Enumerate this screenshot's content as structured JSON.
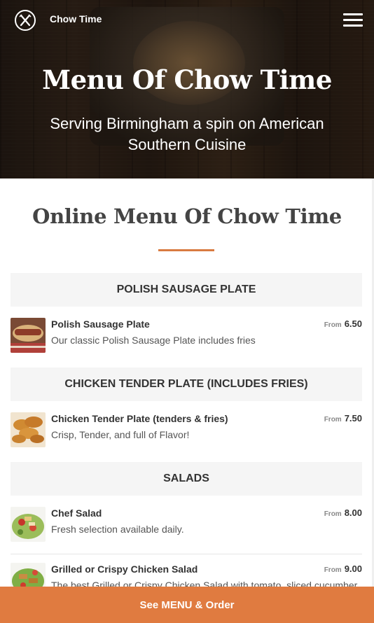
{
  "header": {
    "brand": "Chow Time",
    "logo_icon": "fork-knife-circle-icon",
    "menu_icon": "hamburger-menu-icon"
  },
  "hero": {
    "title": "Menu Of Chow Time",
    "subtitle": "Serving Birmingham a spin on American Southern Cuisine"
  },
  "section": {
    "title": "Online Menu Of Chow Time",
    "accent_color": "#d97b41"
  },
  "menu": {
    "categories": [
      {
        "name": "POLISH SAUSAGE PLATE",
        "items": [
          {
            "name": "Polish Sausage Plate",
            "description": "Our classic Polish Sausage Plate includes fries",
            "from_label": "From",
            "price": "6.50"
          }
        ]
      },
      {
        "name": "CHICKEN TENDER PLATE (INCLUDES FRIES)",
        "items": [
          {
            "name": "Chicken Tender Plate (tenders & fries)",
            "description": "Crisp, Tender, and full of Flavor!",
            "from_label": "From",
            "price": "7.50"
          }
        ]
      },
      {
        "name": "SALADS",
        "items": [
          {
            "name": "Chef Salad",
            "description": "Fresh selection available daily.",
            "from_label": "From",
            "price": "8.00"
          },
          {
            "name": "Grilled or Crispy Chicken Salad",
            "description": "The best Grilled or Crispy Chicken Salad with tomato, sliced cucumber",
            "from_label": "From",
            "price": "9.00"
          }
        ]
      }
    ]
  },
  "cta": {
    "label": "See MENU & Order",
    "color": "#e07b40"
  }
}
